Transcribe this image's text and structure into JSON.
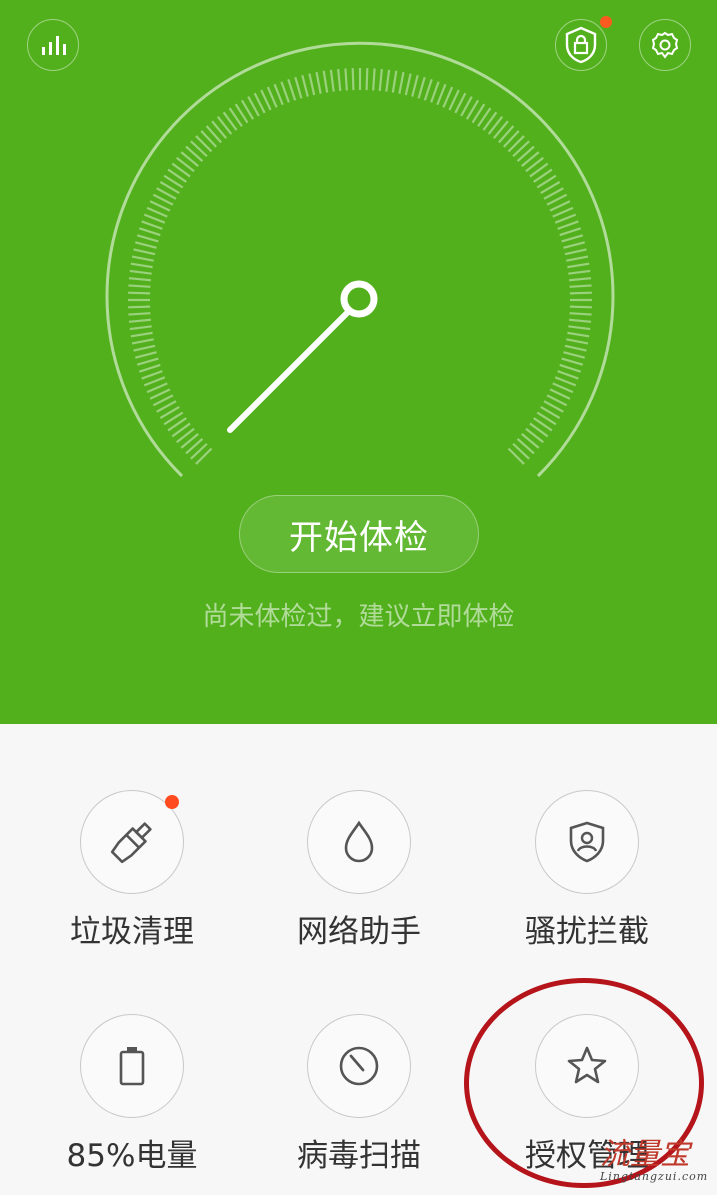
{
  "header": {
    "start_button": "开始体检",
    "hint": "尚未体检过，建议立即体检"
  },
  "tools": [
    {
      "label": "垃圾清理",
      "icon": "broom-icon",
      "badge": true
    },
    {
      "label": "网络助手",
      "icon": "water-drop-icon",
      "badge": false
    },
    {
      "label": "骚扰拦截",
      "icon": "shield-user-icon",
      "badge": false
    },
    {
      "label": "85%电量",
      "icon": "battery-icon",
      "badge": false
    },
    {
      "label": "病毒扫描",
      "icon": "scan-dial-icon",
      "badge": false
    },
    {
      "label": "授权管理",
      "icon": "star-icon",
      "badge": false
    }
  ],
  "watermark": {
    "text": "流量宝",
    "url": "Lingtangzui.com"
  },
  "colors": {
    "primary_green": "#52b01d",
    "badge_orange": "#ff5a1f",
    "annotation_red": "#b4141a"
  }
}
